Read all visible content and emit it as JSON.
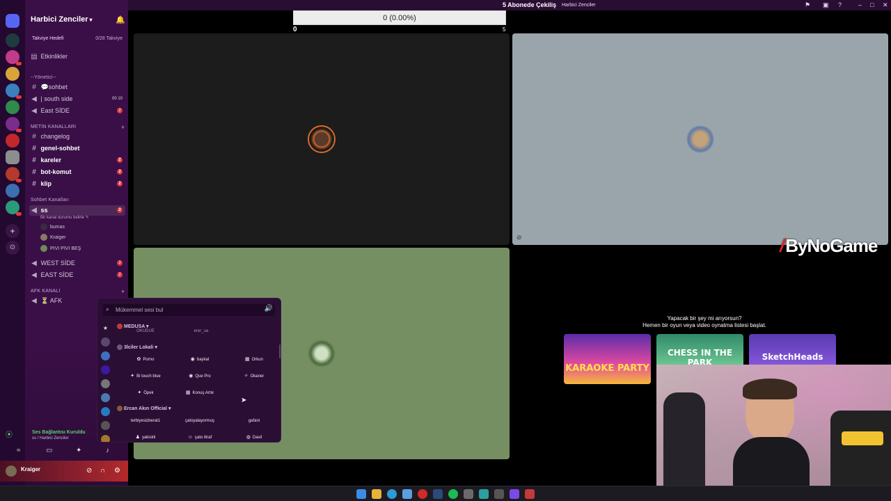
{
  "server": {
    "name": "Harbici Zenciler",
    "goal_label": "Takviye Hedefi",
    "goal_progress": "0/28 Takviye"
  },
  "channels": {
    "events": "Etkinlikler",
    "cat_yonetici": "--Yönetici--",
    "sohbet": "💬sohbet",
    "south_side": "| south side",
    "south_side_counts": "00 10",
    "east_side_1": "East SİDE",
    "cat_metin": "METİN KANALLARI",
    "changelog": "changelog",
    "genel_sohbet": "genel-sohbet",
    "kareler": "kareler",
    "bot_komut": "bot-komut",
    "klip": "klip",
    "cat_sohbet": "Sohbet Kanalları",
    "ss": "ss",
    "ss_status": "Bir kanal durumu belirle",
    "ss_users": [
      "bumas",
      "Kraiger",
      "PIVI PIVI BEŞ"
    ],
    "west_side": "WEST SİDE",
    "east_side_2": "EAST SİDE",
    "cat_afk": "AFK KANALI",
    "afk": "⏳ AFK",
    "badge": "2"
  },
  "voice_status": {
    "title": "Ses Bağlantısı Kuruldu",
    "subtitle": "ss / Harbici Zenciler"
  },
  "user": {
    "name": "Kraiger"
  },
  "stream": {
    "title": "5 Abonede Çekiliş",
    "guild": "Harbici Zenciler",
    "progress_text": "0 (0.00%)",
    "progress_value": 0,
    "progress_min": "0",
    "progress_max": "5"
  },
  "soundboard": {
    "placeholder": "Mükemmel sesi bul",
    "groups": {
      "medusa": "MEDUSA",
      "lokali": "3İciler Lokali",
      "ercan": "Ercan Akın Official"
    },
    "top_partial": [
      "OKUDUE",
      "erer_ua"
    ],
    "sounds_row1": [
      "Porno",
      "baykal",
      "Orkun"
    ],
    "sounds_row2": [
      "Bi touch blue",
      "Que Pro",
      "Okaner"
    ],
    "sounds_row3": [
      "Öpek",
      "Konuş Artık"
    ],
    "sounds_row4": [
      "terbiyesizberat1",
      "çatoyalayormuş",
      "gafani"
    ],
    "sounds_row5": [
      "yakiskli",
      "çato itiraf",
      "Davil"
    ]
  },
  "activities": {
    "prompt_line1": "Yapacak bir şey mi arıyorsun?",
    "prompt_line2": "Hemen bir oyun veya video oynatma listesi başlat.",
    "cards": [
      "KARAOKE PARTY",
      "CHESS IN THE PARK",
      "SketchHeads"
    ]
  },
  "branding": {
    "text": "ByNoGame"
  },
  "colors": {
    "sidebar": "#3a0f47",
    "stage_bg": "#000000",
    "tile_dark": "#1c1c1c",
    "tile_gray": "#9aa5ab",
    "tile_green": "#758f63",
    "unread_badge": "#d9383c",
    "connected": "#56d46c"
  }
}
